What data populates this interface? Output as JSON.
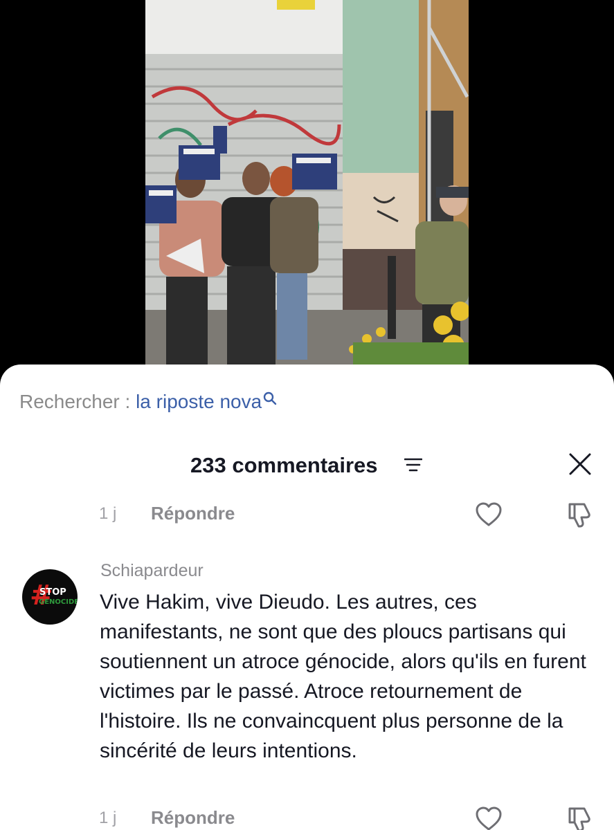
{
  "search": {
    "prefix": "Rechercher : ",
    "query": "la riposte nova",
    "icon": "search-icon"
  },
  "comments_header": {
    "count_label": "233 commentaires",
    "sort_icon": "filter-lines-icon",
    "close_icon": "close-icon"
  },
  "previous_comment": {
    "time": "1 j",
    "reply_label": "Répondre"
  },
  "comment": {
    "username": "Schiapardeur",
    "avatar_text": {
      "hash": "#",
      "line1": "STOP",
      "line2": "GENOCIDE"
    },
    "text": "Vive Hakim, vive Dieudo. Les autres, ces manifestants, ne sont que des ploucs partisans qui soutiennent un atroce génocide, alors qu'ils en furent victimes par le passé. Atroce retournement de l'histoire. Ils ne convaincquent plus personne de la sincérité de leurs intentions.",
    "time": "1 j",
    "reply_label": "Répondre"
  },
  "colors": {
    "link": "#3b5fa8",
    "primary_text": "#161823",
    "secondary_text": "#8a8a8e",
    "sheet_bg": "#ffffff"
  }
}
